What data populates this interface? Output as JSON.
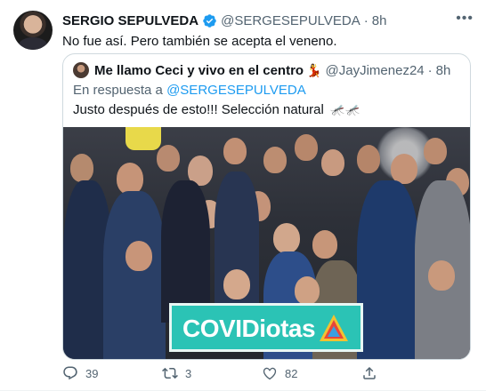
{
  "tweet": {
    "display_name": "SERGIO SEPULVEDA",
    "handle": "@SERGESEPULVEDA",
    "time": "8h",
    "text": "No fue así. Pero también se acepta el veneno.",
    "more_label": "•••"
  },
  "quote": {
    "display_name": "Me llamo Ceci y vivo en el centro",
    "emoji": "💃",
    "handle": "@JayJimenez24",
    "time": "8h",
    "reply_prefix": "En respuesta a",
    "reply_mention": "@SERGESEPULVEDA",
    "text": "Justo después de esto!!! Selección natural",
    "text_emoji": "🦟🦟",
    "banner_cov": "COV",
    "banner_idiotas": "IDiotas"
  },
  "actions": {
    "replies": "39",
    "retweets": "3",
    "likes": "82"
  },
  "colors": {
    "accent": "#1d9bf0",
    "secondary_text": "#536471",
    "banner": "#2bc3b5"
  },
  "icons": [
    "verified-badge-icon",
    "more-icon",
    "reply-icon",
    "retweet-icon",
    "like-icon",
    "share-icon"
  ]
}
